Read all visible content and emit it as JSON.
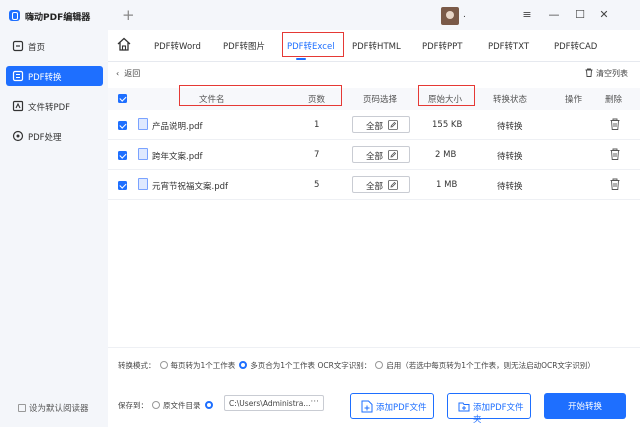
{
  "app": {
    "title": "嗨动PDF编辑器",
    "user_name": "."
  },
  "window_controls": {
    "menu": "≡",
    "minimize": "—",
    "maximize": "☐",
    "close": "✕"
  },
  "sidebar": {
    "items": [
      {
        "label": "首页",
        "icon": "home-icon"
      },
      {
        "label": "PDF转换",
        "icon": "convert-icon",
        "active": true
      },
      {
        "label": "文件转PDF",
        "icon": "file-to-pdf-icon"
      },
      {
        "label": "PDF处理",
        "icon": "pdf-process-icon"
      }
    ],
    "default_reader": "设为默认阅读器"
  },
  "tabs": [
    {
      "label": "PDF转Word"
    },
    {
      "label": "PDF转图片"
    },
    {
      "label": "PDF转Excel",
      "active": true
    },
    {
      "label": "PDF转HTML"
    },
    {
      "label": "PDF转PPT"
    },
    {
      "label": "PDF转TXT"
    },
    {
      "label": "PDF转CAD"
    }
  ],
  "toolbar": {
    "back": "返回",
    "clear_list": "清空列表"
  },
  "table": {
    "headers": {
      "filename": "文件名",
      "pages": "页数",
      "page_select": "页码选择",
      "original_size": "原始大小",
      "status": "转换状态",
      "operation": "操作",
      "delete": "删除"
    },
    "rows": [
      {
        "filename": "产品说明.pdf",
        "pages": "1",
        "page_select": "全部",
        "size": "155 KB",
        "status": "待转换"
      },
      {
        "filename": "跨年文案.pdf",
        "pages": "7",
        "page_select": "全部",
        "size": "2 MB",
        "status": "待转换"
      },
      {
        "filename": "元宵节祝福文案.pdf",
        "pages": "5",
        "page_select": "全部",
        "size": "1 MB",
        "status": "待转换"
      }
    ]
  },
  "footer": {
    "mode_label": "转换模式：",
    "mode_option_1": "每页转为1个工作表",
    "mode_option_2": "多页合为1个工作表",
    "ocr_label": "OCR文字识别：",
    "ocr_option": "启用（若选中每页转为1个工作表，则无法启动OCR文字识别）",
    "save_label": "保存到：",
    "save_option": "原文件目录",
    "save_path": "C:\\Users\\Administra...",
    "path_more": "···",
    "add_file": "添加PDF文件",
    "add_folder": "添加PDF文件夹",
    "start": "开始转换"
  },
  "colors": {
    "accent": "#1e6fff",
    "highlight_box": "#e53935"
  }
}
